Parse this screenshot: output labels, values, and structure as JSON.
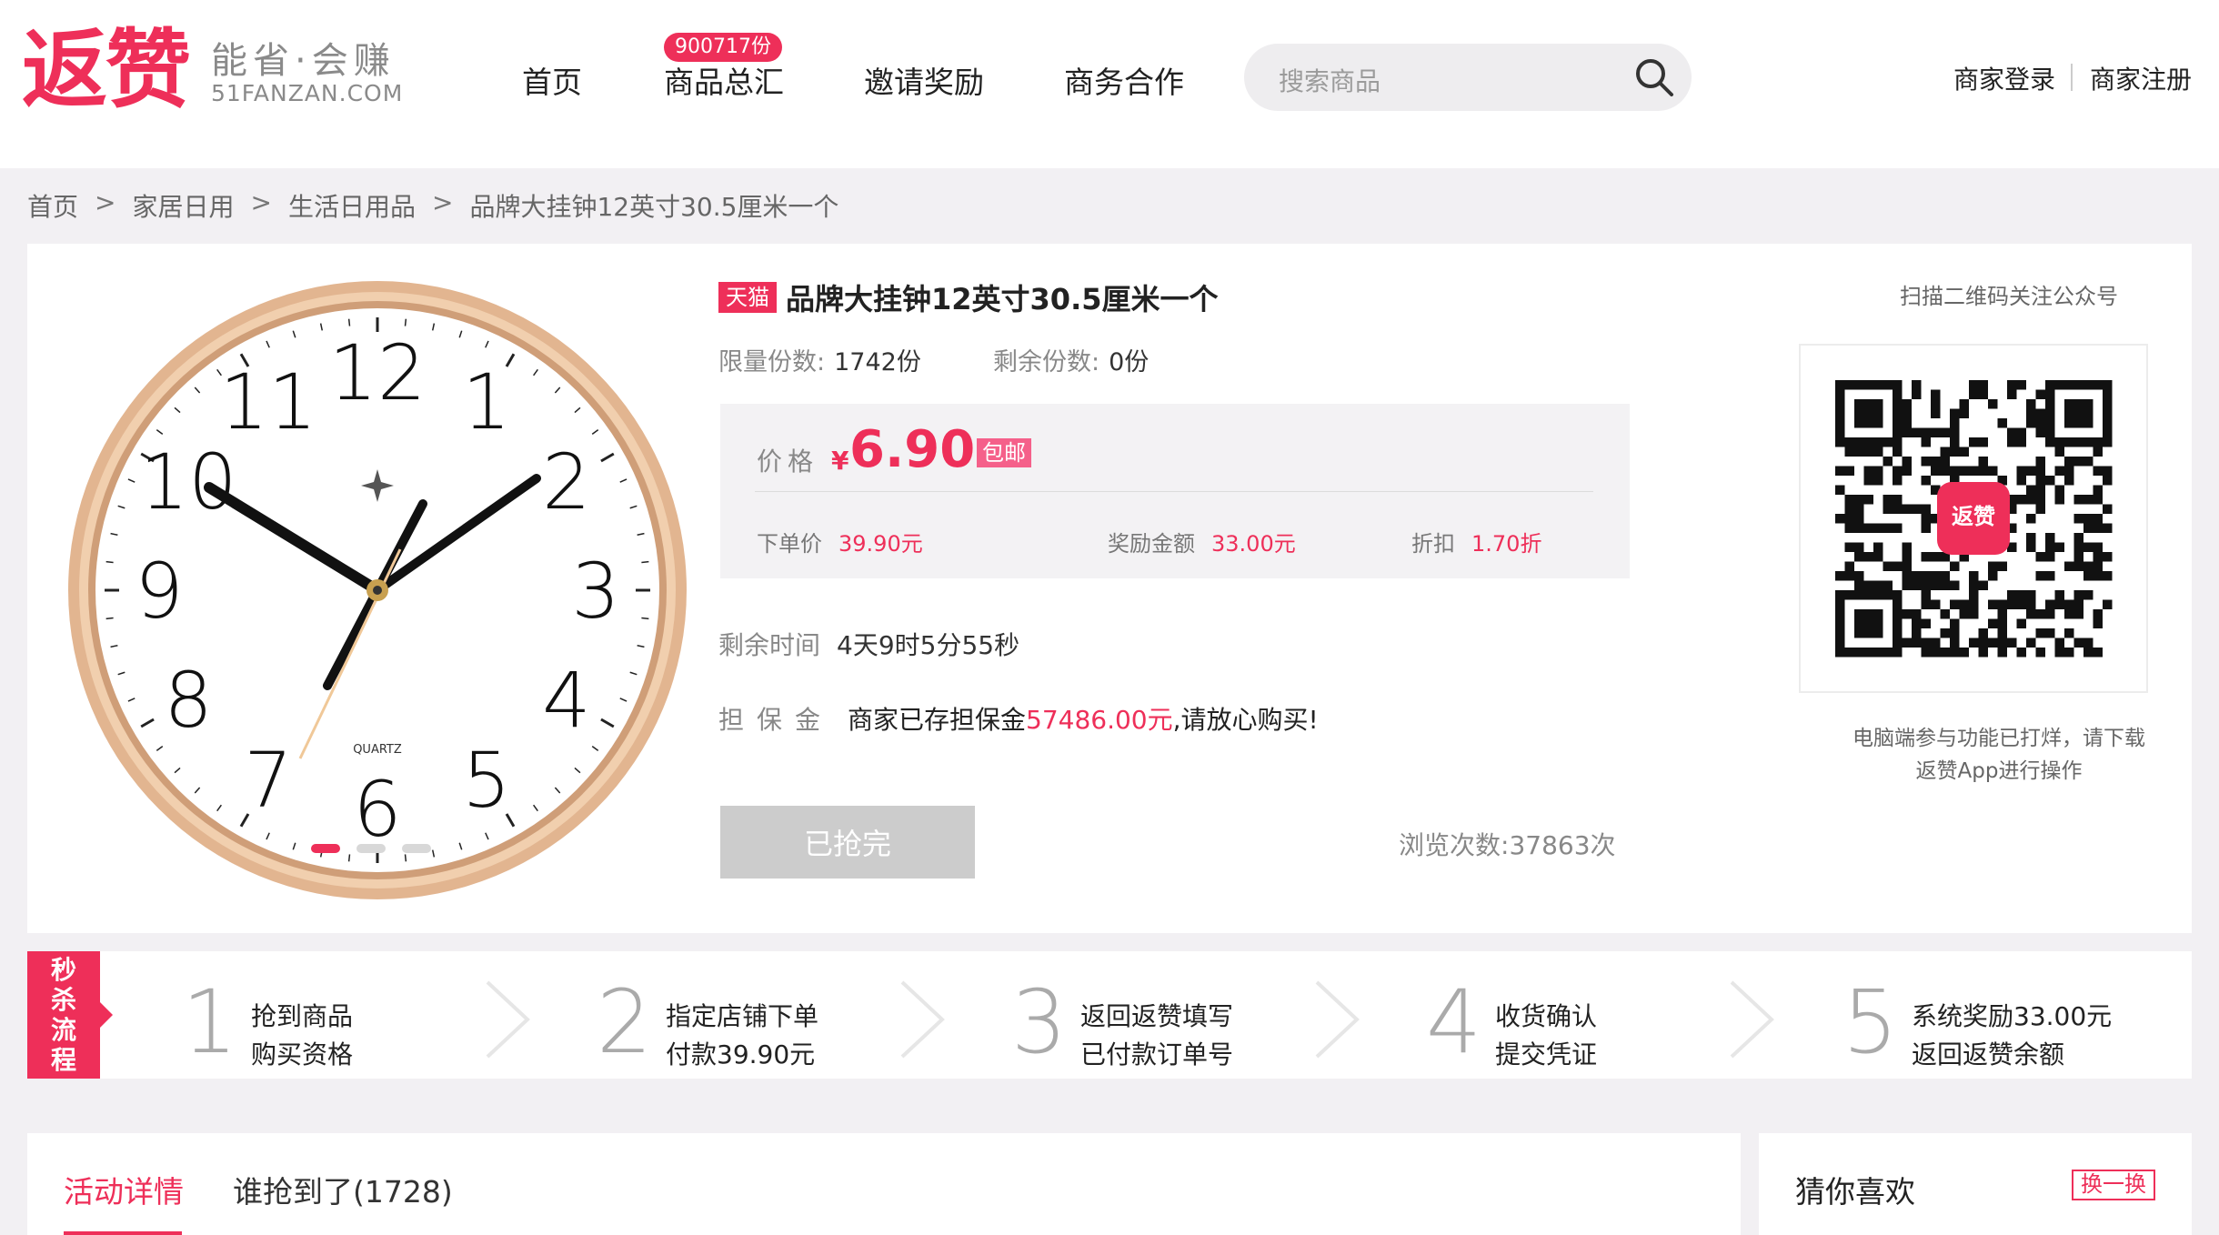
{
  "header": {
    "logo_text": "返赞",
    "slogan": "能省·会赚",
    "url": "51FANZAN.COM",
    "nav": [
      {
        "label": "首页"
      },
      {
        "label": "商品总汇",
        "badge": "900717份"
      },
      {
        "label": "邀请奖励"
      },
      {
        "label": "商务合作"
      }
    ],
    "search_placeholder": "搜索商品",
    "merchant_login": "商家登录",
    "merchant_register": "商家注册"
  },
  "breadcrumb": [
    "首页",
    "家居日用",
    "生活日用品",
    "品牌大挂钟12英寸30.5厘米一个"
  ],
  "breadcrumb_sep": ">",
  "product": {
    "platform_badge": "天猫",
    "title": "品牌大挂钟12英寸30.5厘米一个",
    "limit_label": "限量份数:",
    "limit_value": "1742份",
    "remaining_label": "剩余份数:",
    "remaining_value": "0份",
    "price_label": "价格",
    "currency": "¥",
    "price": "6.90",
    "shipping_badge": "包邮",
    "order_price_label": "下单价",
    "order_price": "39.90元",
    "reward_label": "奖励金额",
    "reward": "33.00元",
    "discount_label": "折扣",
    "discount": "1.70折",
    "time_left_label": "剩余时间",
    "time_left": "4天9时5分55秒",
    "deposit_label": "担保金",
    "deposit_prefix": "商家已存担保金",
    "deposit_amount": "57486.00元",
    "deposit_suffix": ",请放心购买!",
    "button_label": "已抢完",
    "views_label": "浏览次数:",
    "views": "37863次",
    "clock_brand": "QUARTZ",
    "clock_numbers": [
      "12",
      "1",
      "2",
      "3",
      "4",
      "5",
      "6",
      "7",
      "8",
      "9",
      "10",
      "11"
    ]
  },
  "qr": {
    "caption": "扫描二维码关注公众号",
    "center_logo": "返赞",
    "note_line1": "电脑端参与功能已打烊，请下载",
    "note_line2": "返赞App进行操作"
  },
  "process": {
    "tag": [
      "秒",
      "杀",
      "流",
      "程"
    ],
    "steps": [
      {
        "num": "1",
        "line1": "抢到商品",
        "line2": "购买资格"
      },
      {
        "num": "2",
        "line1": "指定店铺下单",
        "line2": "付款39.90元"
      },
      {
        "num": "3",
        "line1": "返回返赞填写",
        "line2": "已付款订单号"
      },
      {
        "num": "4",
        "line1": "收货确认",
        "line2": "提交凭证"
      },
      {
        "num": "5",
        "line1": "系统奖励33.00元",
        "line2": "返回返赞余额"
      }
    ]
  },
  "tabs": [
    {
      "label": "活动详情"
    },
    {
      "label": "谁抢到了(1728)"
    }
  ],
  "guess": {
    "title": "猜你喜欢",
    "refresh": "换一换"
  },
  "colors": {
    "accent": "#ee2f59",
    "clock_rim": "#d9a882",
    "button_disabled": "#cccccc"
  }
}
